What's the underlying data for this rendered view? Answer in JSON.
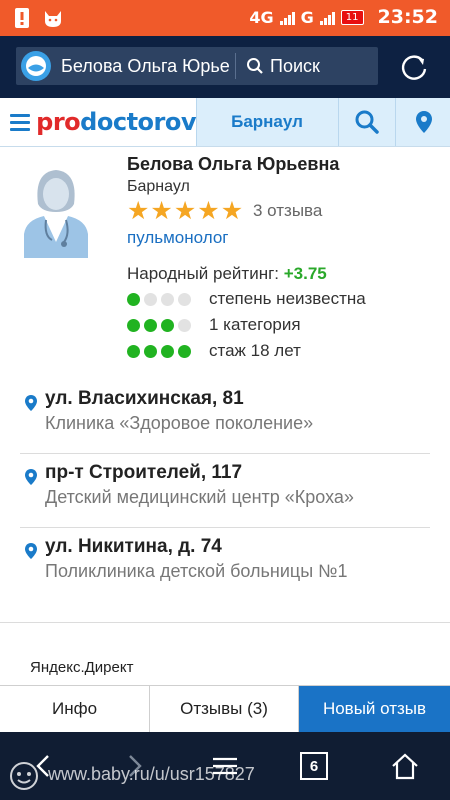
{
  "status_bar": {
    "network_label": "4G",
    "network_type": "4G",
    "second_network": "G",
    "battery_level": "11",
    "time": "23:52"
  },
  "browser": {
    "url_text": "Белова Ольга Юрьевна",
    "search_label": "Поиск"
  },
  "site_nav": {
    "logo_pro": "pro",
    "logo_rest": "doctorov",
    "city": "Барнаул"
  },
  "doctor": {
    "name": "Белова Ольга Юрьевна",
    "city": "Барнаул",
    "stars": 5,
    "reviews": "3 отзыва",
    "specialty": "пульмонолог",
    "rating_label": "Народный рейтинг:",
    "rating_value": "+3.75",
    "indicators": [
      {
        "filled": 1,
        "total": 4,
        "label": "степень неизвестна"
      },
      {
        "filled": 3,
        "total": 4,
        "label": "1 категория"
      },
      {
        "filled": 4,
        "total": 4,
        "label": "стаж 18 лет"
      }
    ]
  },
  "addresses": [
    {
      "street": "ул. Власихинская, 81",
      "clinic": "Клиника «Здоровое поколение»"
    },
    {
      "street": "пр-т Строителей, 117",
      "clinic": "Детский медицинский центр «Кроха»"
    },
    {
      "street": "ул. Никитина, д. 74",
      "clinic": "Поликлиника детской больницы №1"
    }
  ],
  "ad_label": "Яндекс.Директ",
  "tabs": {
    "info": "Инфо",
    "reviews": "Отзывы (3)",
    "new_review": "Новый отзыв"
  },
  "navbar": {
    "tabs_count": "6"
  },
  "watermark": "www.baby.ru/u/usr157827",
  "colors": {
    "status_bar": "#f05a2a",
    "browser_bar": "#0d2142",
    "accent_blue": "#1a73c6",
    "rating_green": "#21b321",
    "star_gold": "#f5a623"
  }
}
